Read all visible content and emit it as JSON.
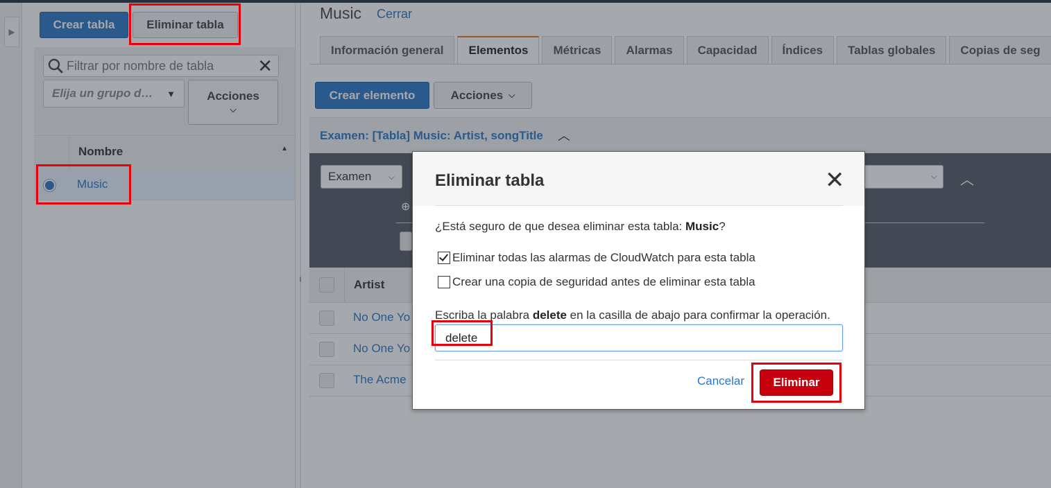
{
  "left_panel": {
    "create_table_label": "Crear tabla",
    "delete_table_label": "Eliminar tabla",
    "filter_placeholder": "Filtrar por nombre de tabla",
    "group_placeholder": "Elija un grupo d…",
    "actions_label": "Acciones",
    "name_header": "Nombre",
    "tables": [
      "Music"
    ]
  },
  "main": {
    "table_title": "Music",
    "close_label": "Cerrar",
    "tabs": [
      "Información general",
      "Elementos",
      "Métricas",
      "Alarmas",
      "Capacidad",
      "Índices",
      "Tablas globales",
      "Copias de seg"
    ],
    "active_tab": "Elementos",
    "create_item_label": "Crear elemento",
    "actions_label": "Acciones",
    "scan_summary": "Examen: [Tabla] Music: Artist, songTitle",
    "scan_mode": "Examen",
    "column_artist": "Artist",
    "rows": [
      "No One Yo",
      "No One Yo",
      "The Acme"
    ]
  },
  "dialog": {
    "title": "Eliminar tabla",
    "question_prefix": "¿Está seguro de que desea eliminar esta tabla: ",
    "question_table": "Music",
    "question_suffix": "?",
    "option_alarms": "Eliminar todas las alarmas de CloudWatch para esta tabla",
    "option_alarms_checked": true,
    "option_backup": "Crear una copia de seguridad antes de eliminar esta tabla",
    "option_backup_checked": false,
    "confirm_prefix": "Escriba la palabra ",
    "confirm_word": "delete",
    "confirm_suffix": " en la casilla de abajo para confirmar la operación.",
    "input_value": "delete",
    "cancel_label": "Cancelar",
    "delete_label": "Eliminar"
  },
  "colors": {
    "primary": "#2b77c7",
    "danger": "#c7000d",
    "highlight": "#e8000a",
    "tab_accent": "#e47911"
  }
}
